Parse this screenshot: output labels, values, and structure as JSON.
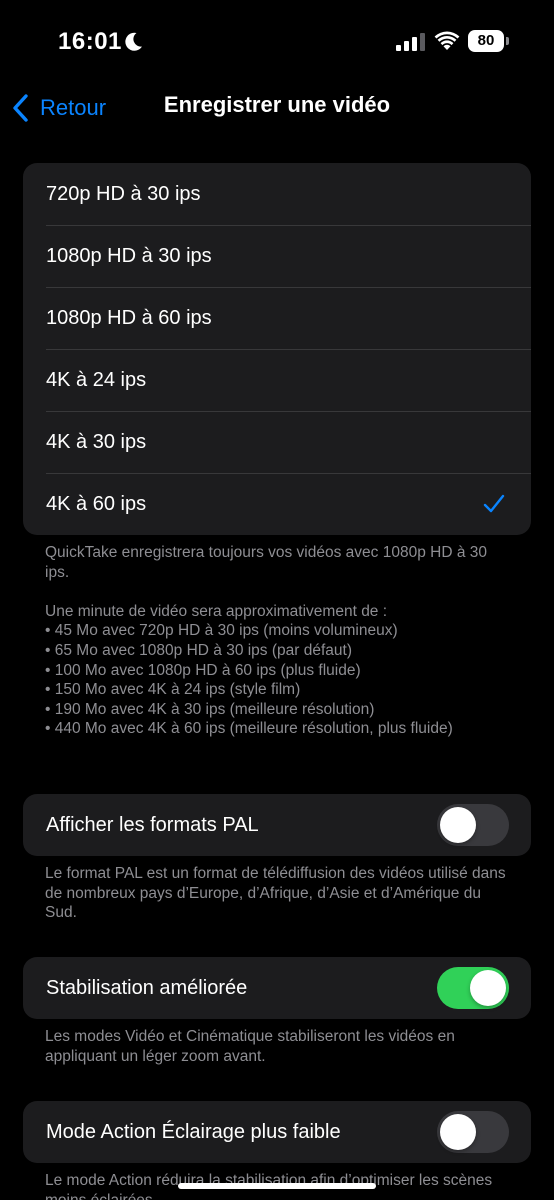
{
  "status": {
    "time": "16:01",
    "battery": "80"
  },
  "nav": {
    "back_label": "Retour",
    "title": "Enregistrer une vidéo"
  },
  "formats": {
    "options": [
      {
        "label": "720p HD à 30 ips",
        "selected": false
      },
      {
        "label": "1080p HD à 30 ips",
        "selected": false
      },
      {
        "label": "1080p HD à 60 ips",
        "selected": false
      },
      {
        "label": "4K à 24 ips",
        "selected": false
      },
      {
        "label": "4K à 30 ips",
        "selected": false
      },
      {
        "label": "4K à 60 ips",
        "selected": true
      }
    ],
    "footnote_quicktake": "QuickTake enregistrera toujours vos vidéos avec 1080p HD à 30 ips.",
    "footnote_sizes_intro": "Une minute de vidéo sera approximativement de :",
    "footnote_sizes": [
      "• 45 Mo avec 720p HD à 30 ips (moins volumineux)",
      "• 65 Mo avec 1080p HD à 30 ips (par défaut)",
      "• 100 Mo avec 1080p HD à 60 ips (plus fluide)",
      "• 150 Mo avec 4K à 24 ips (style film)",
      "• 190 Mo avec 4K à 30 ips (meilleure résolution)",
      "• 440 Mo avec 4K à 60 ips (meilleure résolution, plus fluide)"
    ]
  },
  "pal": {
    "label": "Afficher les formats PAL",
    "enabled": false,
    "footnote": "Le format PAL est un format de télédiffusion des vidéos utilisé dans de nombreux pays d’Europe, d’Afrique, d’Asie et d’Amérique du Sud."
  },
  "stabilization": {
    "label": "Stabilisation améliorée",
    "enabled": true,
    "footnote": "Les modes Vidéo et Cinématique stabiliseront les vidéos en appliquant un léger zoom avant."
  },
  "action_mode": {
    "label": "Mode Action Éclairage plus faible",
    "enabled": false,
    "footnote": "Le mode Action réduira la stabilisation afin d’optimiser les scènes moins éclairées."
  },
  "colors": {
    "accent": "#0a84ff",
    "toggle_on": "#30d158",
    "toggle_off": "#39393d",
    "cell_bg": "#1c1c1e",
    "footnote_text": "#8e8e93"
  }
}
